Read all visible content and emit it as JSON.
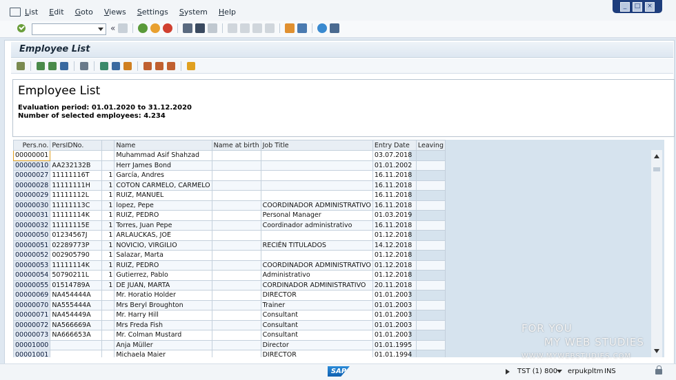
{
  "menu": [
    "List",
    "Edit",
    "Goto",
    "Views",
    "Settings",
    "System",
    "Help"
  ],
  "window_controls": [
    "_",
    "□",
    "×"
  ],
  "page_title": "Employee List",
  "header": {
    "title": "Employee List",
    "evaluation_period": "Evaluation period: 01.01.2020 to 31.12.2020",
    "selected_count": "Number of selected employees: 4.234"
  },
  "table": {
    "columns": [
      "Pers.no.",
      "PersIDNo.",
      "",
      "Name",
      "Name at birth",
      "Job Title",
      "Entry Date",
      "Leaving"
    ],
    "rows": [
      [
        "00000001",
        "",
        "",
        "Muhammad Asif Shahzad",
        "",
        "",
        "03.07.2018",
        ""
      ],
      [
        "00000010",
        "AA232132B",
        "",
        "Herr James Bond",
        "",
        "",
        "01.01.2002",
        ""
      ],
      [
        "00000027",
        "11111116T",
        "1",
        "García, Andres",
        "",
        "",
        "16.11.2018",
        ""
      ],
      [
        "00000028",
        "11111111H",
        "1",
        "COTON CARMELO, CARMELO",
        "",
        "",
        "16.11.2018",
        ""
      ],
      [
        "00000029",
        "11111112L",
        "1",
        "RUIZ, MANUEL",
        "",
        "",
        "16.11.2018",
        ""
      ],
      [
        "00000030",
        "11111113C",
        "1",
        "lopez, Pepe",
        "",
        "COORDINADOR ADMINISTRATIVO",
        "16.11.2018",
        ""
      ],
      [
        "00000031",
        "11111114K",
        "1",
        "RUIZ, PEDRO",
        "",
        "Personal Manager",
        "01.03.2019",
        ""
      ],
      [
        "00000032",
        "11111115E",
        "1",
        "Torres, Juan Pepe",
        "",
        "Coordinador administrativo",
        "16.11.2018",
        ""
      ],
      [
        "00000050",
        "01234567J",
        "1",
        "ARLAUCKAS, JOE",
        "",
        "",
        "01.12.2018",
        ""
      ],
      [
        "00000051",
        "02289773P",
        "1",
        "NOVICIO, VIRGILIO",
        "",
        "RECIÉN TITULADOS",
        "14.12.2018",
        ""
      ],
      [
        "00000052",
        "002905790",
        "1",
        "Salazar, Marta",
        "",
        "",
        "01.12.2018",
        ""
      ],
      [
        "00000053",
        "11111114K",
        "1",
        "RUIZ, PEDRO",
        "",
        "COORDINADOR ADMINISTRATIVO",
        "01.12.2018",
        ""
      ],
      [
        "00000054",
        "50790211L",
        "1",
        "Gutierrez, Pablo",
        "",
        "Administrativo",
        "01.12.2018",
        ""
      ],
      [
        "00000055",
        "01514789A",
        "1",
        "DE JUAN, MARTA",
        "",
        "CORDINADOR ADMINISTRATIVO",
        "20.11.2018",
        ""
      ],
      [
        "00000069",
        "NA454444A",
        "",
        "Mr. Horatio Holder",
        "",
        "DIRECTOR",
        "01.01.2003",
        ""
      ],
      [
        "00000070",
        "NA555444A",
        "",
        "Mrs Beryl Broughton",
        "",
        "Trainer",
        "01.01.2003",
        ""
      ],
      [
        "00000071",
        "NA454449A",
        "",
        "Mr. Harry Hill",
        "",
        "Consultant",
        "01.01.2003",
        ""
      ],
      [
        "00000072",
        "NA566669A",
        "",
        "Mrs Freda Fish",
        "",
        "Consultant",
        "01.01.2003",
        ""
      ],
      [
        "00000073",
        "NA666653A",
        "",
        "Mr. Colman Mustard",
        "",
        "Consultant",
        "01.01.2003",
        ""
      ],
      [
        "00001000",
        "",
        "",
        "Anja Müller",
        "",
        "Director",
        "01.01.1995",
        ""
      ],
      [
        "00001001",
        "",
        "",
        "Michaela Maier",
        "",
        "DIRECTOR",
        "01.01.1994",
        ""
      ]
    ]
  },
  "status": {
    "logo": "SAP",
    "system": "TST (1) 800",
    "server": "erpukpltm",
    "mode": "INS"
  },
  "watermark": {
    "line1": "FOR YOU",
    "line2": "MY WEB STUDIES",
    "line3": "WWW.MYWEBSTUDIES.COM"
  },
  "colors": {
    "accent": "#1d3d7c",
    "selection_border": "#e0a020",
    "grid_empty": "#d6e3ee"
  }
}
